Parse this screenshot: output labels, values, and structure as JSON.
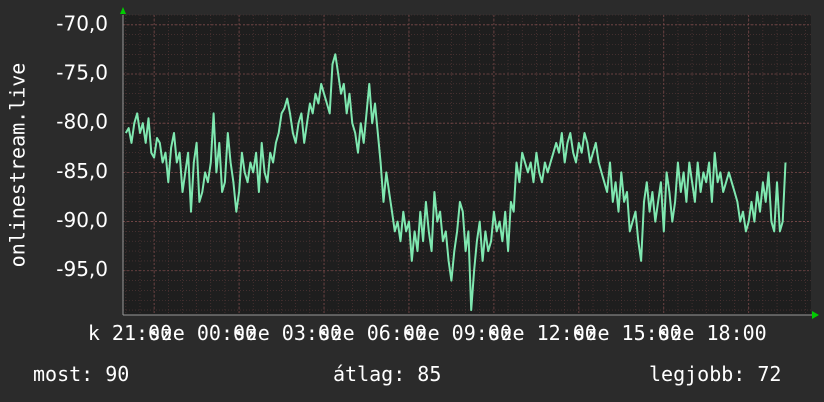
{
  "chart_data": {
    "type": "line",
    "ylabel": "onlinestream.live",
    "ylim": [
      -99.5,
      -69
    ],
    "y_ticks": [
      "-70,0",
      "-75,0",
      "-80,0",
      "-85,0",
      "-90,0",
      "-95,0"
    ],
    "y_tick_values": [
      -70,
      -75,
      -80,
      -85,
      -90,
      -95
    ],
    "x_ticks": [
      "k 21:00",
      "sze 00:00",
      "sze 03:00",
      "sze 06:00",
      "sze 09:00",
      "sze 12:00",
      "sze 15:00",
      "sze 18:00"
    ],
    "x_tick_hours": [
      21,
      24,
      27,
      30,
      33,
      36,
      39,
      42
    ],
    "xlim_hours": [
      19.9,
      44.2
    ],
    "grid": true,
    "series": [
      {
        "color": "#7fe8b0",
        "x_hours": [
          20.0,
          20.1,
          20.2,
          20.3,
          20.4,
          20.5,
          20.6,
          20.7,
          20.8,
          20.9,
          21.0,
          21.1,
          21.2,
          21.3,
          21.4,
          21.5,
          21.6,
          21.7,
          21.8,
          21.9,
          22.0,
          22.1,
          22.2,
          22.3,
          22.4,
          22.5,
          22.6,
          22.7,
          22.8,
          22.9,
          23.0,
          23.1,
          23.2,
          23.3,
          23.4,
          23.5,
          23.6,
          23.7,
          23.8,
          23.9,
          24.0,
          24.1,
          24.2,
          24.3,
          24.4,
          24.5,
          24.6,
          24.7,
          24.8,
          24.9,
          25.0,
          25.1,
          25.2,
          25.3,
          25.4,
          25.5,
          25.6,
          25.7,
          25.8,
          25.9,
          26.0,
          26.1,
          26.2,
          26.3,
          26.4,
          26.5,
          26.6,
          26.7,
          26.8,
          26.9,
          27.0,
          27.1,
          27.2,
          27.3,
          27.4,
          27.5,
          27.6,
          27.7,
          27.8,
          27.9,
          28.0,
          28.1,
          28.2,
          28.3,
          28.4,
          28.5,
          28.6,
          28.7,
          28.8,
          28.9,
          29.0,
          29.1,
          29.2,
          29.3,
          29.4,
          29.5,
          29.6,
          29.7,
          29.8,
          29.9,
          30.0,
          30.1,
          30.2,
          30.3,
          30.4,
          30.5,
          30.6,
          30.7,
          30.8,
          30.9,
          31.0,
          31.1,
          31.2,
          31.3,
          31.4,
          31.5,
          31.6,
          31.7,
          31.8,
          31.9,
          32.0,
          32.1,
          32.2,
          32.3,
          32.4,
          32.5,
          32.6,
          32.7,
          32.8,
          32.9,
          33.0,
          33.1,
          33.2,
          33.3,
          33.4,
          33.5,
          33.6,
          33.7,
          33.8,
          33.9,
          34.0,
          34.1,
          34.2,
          34.3,
          34.4,
          34.5,
          34.6,
          34.7,
          34.8,
          34.9,
          35.0,
          35.1,
          35.2,
          35.3,
          35.4,
          35.5,
          35.6,
          35.7,
          35.8,
          35.9,
          36.0,
          36.1,
          36.2,
          36.3,
          36.4,
          36.5,
          36.6,
          36.7,
          36.8,
          36.9,
          37.0,
          37.1,
          37.2,
          37.3,
          37.4,
          37.5,
          37.6,
          37.7,
          37.8,
          37.9,
          38.0,
          38.1,
          38.2,
          38.3,
          38.4,
          38.5,
          38.6,
          38.7,
          38.8,
          38.9,
          39.0,
          39.1,
          39.2,
          39.3,
          39.4,
          39.5,
          39.6,
          39.7,
          39.8,
          39.9,
          40.0,
          40.1,
          40.2,
          40.3,
          40.4,
          40.5,
          40.6,
          40.7,
          40.8,
          40.9,
          41.0,
          41.1,
          41.2,
          41.3,
          41.4,
          41.5,
          41.6,
          41.7,
          41.8,
          41.9,
          42.0,
          42.1,
          42.2,
          42.3,
          42.4,
          42.5,
          42.6,
          42.7,
          42.8,
          42.9,
          43.0,
          43.1,
          43.2,
          43.3,
          43.4,
          43.5,
          43.6,
          43.7,
          43.8,
          43.9
        ],
        "values": [
          -81.0,
          -80.5,
          -82.0,
          -80.0,
          -79.0,
          -81.0,
          -80.0,
          -82.0,
          -79.5,
          -83.0,
          -83.5,
          -81.5,
          -82.0,
          -84.0,
          -83.0,
          -86.0,
          -82.5,
          -81.0,
          -84.0,
          -83.0,
          -87.0,
          -85.0,
          -83.0,
          -89.0,
          -84.0,
          -82.0,
          -88.0,
          -87.0,
          -85.0,
          -86.0,
          -84.0,
          -79.0,
          -85.0,
          -82.0,
          -87.0,
          -86.0,
          -81.0,
          -84.0,
          -86.0,
          -89.0,
          -87.0,
          -83.0,
          -85.0,
          -86.0,
          -84.0,
          -85.0,
          -83.0,
          -87.0,
          -82.0,
          -85.0,
          -86.0,
          -83.0,
          -84.0,
          -82.0,
          -81.0,
          -79.0,
          -78.5,
          -77.5,
          -79.0,
          -81.0,
          -82.0,
          -80.0,
          -79.0,
          -82.0,
          -80.0,
          -78.0,
          -79.0,
          -77.0,
          -78.0,
          -76.0,
          -77.0,
          -78.0,
          -79.0,
          -74.0,
          -73.0,
          -75.0,
          -77.0,
          -76.0,
          -79.0,
          -77.0,
          -80.0,
          -81.0,
          -83.0,
          -80.0,
          -82.0,
          -79.0,
          -76.0,
          -80.0,
          -78.0,
          -81.0,
          -84.0,
          -88.0,
          -85.0,
          -87.0,
          -89.0,
          -91.0,
          -90.0,
          -92.0,
          -89.0,
          -91.0,
          -90.0,
          -94.0,
          -91.0,
          -93.0,
          -89.0,
          -92.0,
          -88.0,
          -91.0,
          -93.0,
          -87.0,
          -90.0,
          -89.0,
          -92.0,
          -91.0,
          -94.0,
          -96.0,
          -93.0,
          -91.0,
          -88.0,
          -89.0,
          -93.0,
          -91.0,
          -99.0,
          -95.0,
          -92.0,
          -90.0,
          -94.0,
          -91.0,
          -93.0,
          -92.0,
          -89.0,
          -91.0,
          -90.0,
          -92.0,
          -89.0,
          -93.0,
          -88.0,
          -89.0,
          -84.0,
          -86.0,
          -83.0,
          -84.0,
          -85.0,
          -84.0,
          -86.0,
          -83.0,
          -85.0,
          -86.0,
          -84.0,
          -85.0,
          -84.0,
          -83.0,
          -82.0,
          -83.0,
          -81.0,
          -84.0,
          -82.0,
          -81.0,
          -83.0,
          -84.0,
          -82.0,
          -83.0,
          -81.0,
          -82.0,
          -84.0,
          -83.0,
          -82.0,
          -84.0,
          -85.0,
          -86.0,
          -87.0,
          -84.0,
          -88.0,
          -86.0,
          -89.0,
          -85.0,
          -88.0,
          -87.0,
          -91.0,
          -90.0,
          -89.0,
          -92.0,
          -94.0,
          -88.0,
          -86.0,
          -89.0,
          -87.0,
          -90.0,
          -88.0,
          -86.0,
          -91.0,
          -85.0,
          -87.0,
          -90.0,
          -88.0,
          -84.0,
          -87.0,
          -85.0,
          -88.0,
          -84.0,
          -86.0,
          -88.0,
          -84.0,
          -87.0,
          -85.0,
          -86.0,
          -84.0,
          -88.0,
          -83.0,
          -86.0,
          -85.0,
          -87.0,
          -86.0,
          -85.0,
          -86.0,
          -87.0,
          -88.0,
          -90.0,
          -89.0,
          -91.0,
          -90.0,
          -88.0,
          -90.0,
          -87.0,
          -89.0,
          -86.0,
          -88.0,
          -85.0,
          -90.0,
          -91.0,
          -86.0,
          -91.0,
          -90.0,
          -84.0
        ]
      }
    ]
  },
  "stats": {
    "current": "most: 90",
    "average": "átlag: 85",
    "best": "legjobb: 72"
  }
}
